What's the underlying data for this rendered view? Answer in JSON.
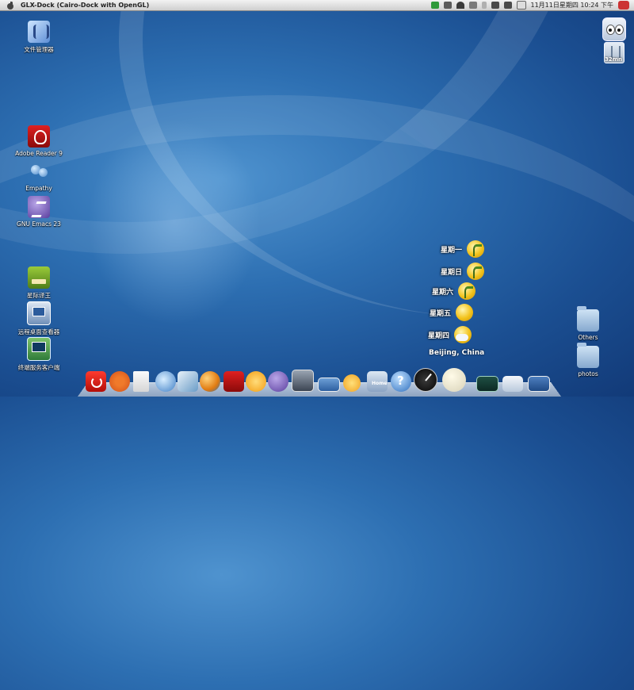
{
  "topbar": {
    "app_title": "GLX-Dock (Cairo-Dock with OpenGL)",
    "clock": "11月11日星期四 10:24 下午"
  },
  "desktop_icons": {
    "file_manager": "文件管理器",
    "adobe_reader": "Adobe Reader 9",
    "empathy": "Empathy",
    "emacs": "GNU Emacs 23",
    "translator": "星际译王",
    "remote_desktop": "远程桌面查看器",
    "terminal_service": "终端服务客户端",
    "others": "Others",
    "photos": "photos"
  },
  "trash_widget": {
    "label": "32mn"
  },
  "weather": {
    "days": [
      "星期一",
      "星期日",
      "星期六",
      "星期五",
      "星期四"
    ],
    "location": "Beijing, China"
  },
  "dock": {
    "home_label": "Home"
  }
}
